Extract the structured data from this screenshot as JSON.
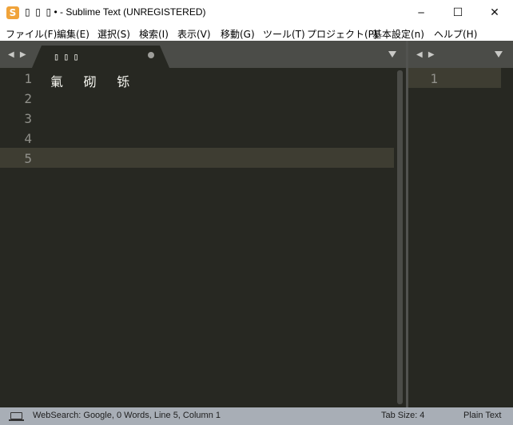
{
  "window": {
    "app_icon_glyph": "S",
    "title": "▯  ▯  ▯ • - Sublime Text (UNREGISTERED)",
    "minimize_glyph": "─",
    "maximize_glyph": "☐",
    "close_glyph": "✕"
  },
  "menu": {
    "items": [
      {
        "label": "ファイル(F)"
      },
      {
        "label": "編集(E)"
      },
      {
        "label": "選択(S)"
      },
      {
        "label": "検索(I)"
      },
      {
        "label": "表示(V)"
      },
      {
        "label": "移動(G)"
      },
      {
        "label": "ツール(T)"
      },
      {
        "label": "プロジェクト(P)"
      },
      {
        "label": "基本設定(n)"
      },
      {
        "label": "ヘルプ(H)"
      }
    ]
  },
  "tabs": {
    "nav_left": "◀ ▶",
    "nav_right": "◀ ▶",
    "active_tab": {
      "title": "▯▯▯",
      "modified": true
    }
  },
  "editor": {
    "line_numbers": [
      "1",
      "2",
      "3",
      "4",
      "5"
    ],
    "current_line": 5,
    "lines": [
      "氭 砌 铄",
      "",
      "",
      "",
      ""
    ]
  },
  "editor2": {
    "line_numbers": [
      "1"
    ]
  },
  "statusbar": {
    "left_text": "WebSearch: Google, 0 Words, Line 5, Column 1",
    "tab_size": "Tab Size: 4",
    "syntax": "Plain Text"
  },
  "colors": {
    "editor_bg": "#272822",
    "line_highlight": "#3e3d32",
    "tabbar_bg": "#4b4c48",
    "statusbar_bg": "#a8aeb6",
    "app_icon": "#f0a33a"
  }
}
